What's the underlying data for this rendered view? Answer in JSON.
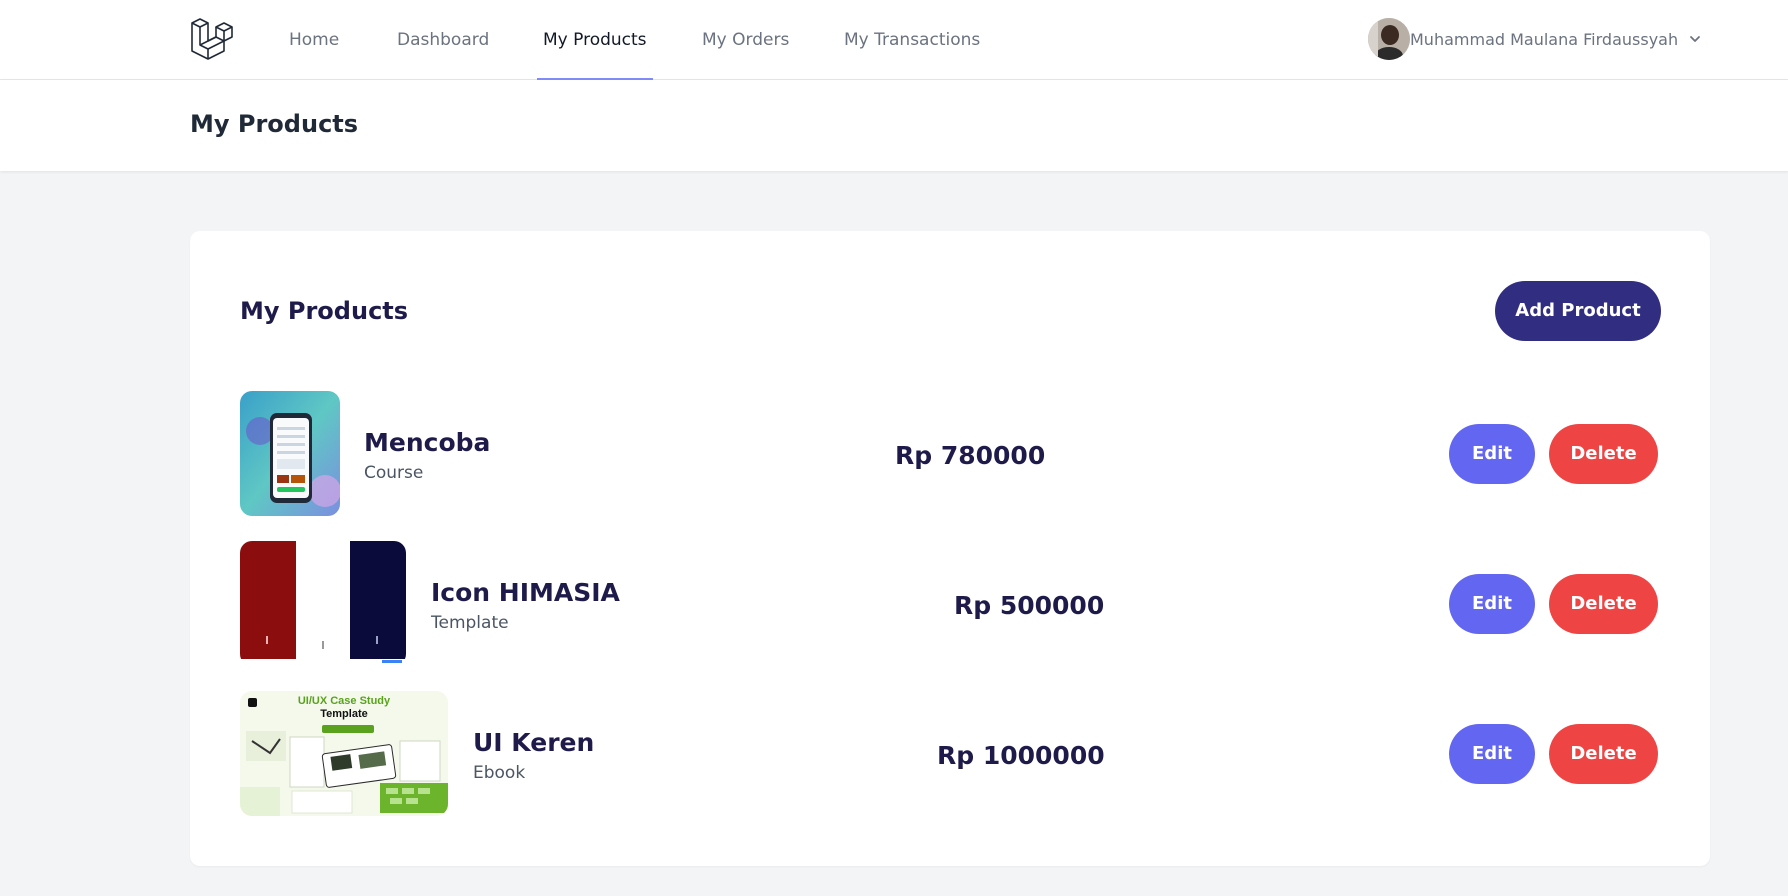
{
  "nav": {
    "links": [
      {
        "label": "Home"
      },
      {
        "label": "Dashboard"
      },
      {
        "label": "My Products"
      },
      {
        "label": "My Orders"
      },
      {
        "label": "My Transactions"
      }
    ],
    "active": "My Products",
    "user_name": "Muhammad Maulana Firdaussyah",
    "logo_icon": "laravel-logo-icon",
    "user_menu_icon": "chevron-down-icon"
  },
  "header": {
    "title": "My Products"
  },
  "card": {
    "title": "My Products",
    "add_label": "Add Product"
  },
  "products": [
    {
      "name": "Mencoba",
      "category": "Course",
      "price": "Rp 780000",
      "edit_label": "Edit",
      "delete_label": "Delete"
    },
    {
      "name": "Icon HIMASIA",
      "category": "Template",
      "price": "Rp 500000",
      "edit_label": "Edit",
      "delete_label": "Delete"
    },
    {
      "name": "UI Keren",
      "category": "Ebook",
      "price": "Rp 1000000",
      "edit_label": "Edit",
      "delete_label": "Delete",
      "thumbnail_text": {
        "line1": "UI/UX Case Study",
        "line2": "Template"
      }
    }
  ],
  "colors": {
    "primary_dark": "#312e81",
    "edit": "#6366f1",
    "delete": "#ef4444",
    "active_underline": "#818cf8",
    "text_dark": "#1e1b4b"
  }
}
